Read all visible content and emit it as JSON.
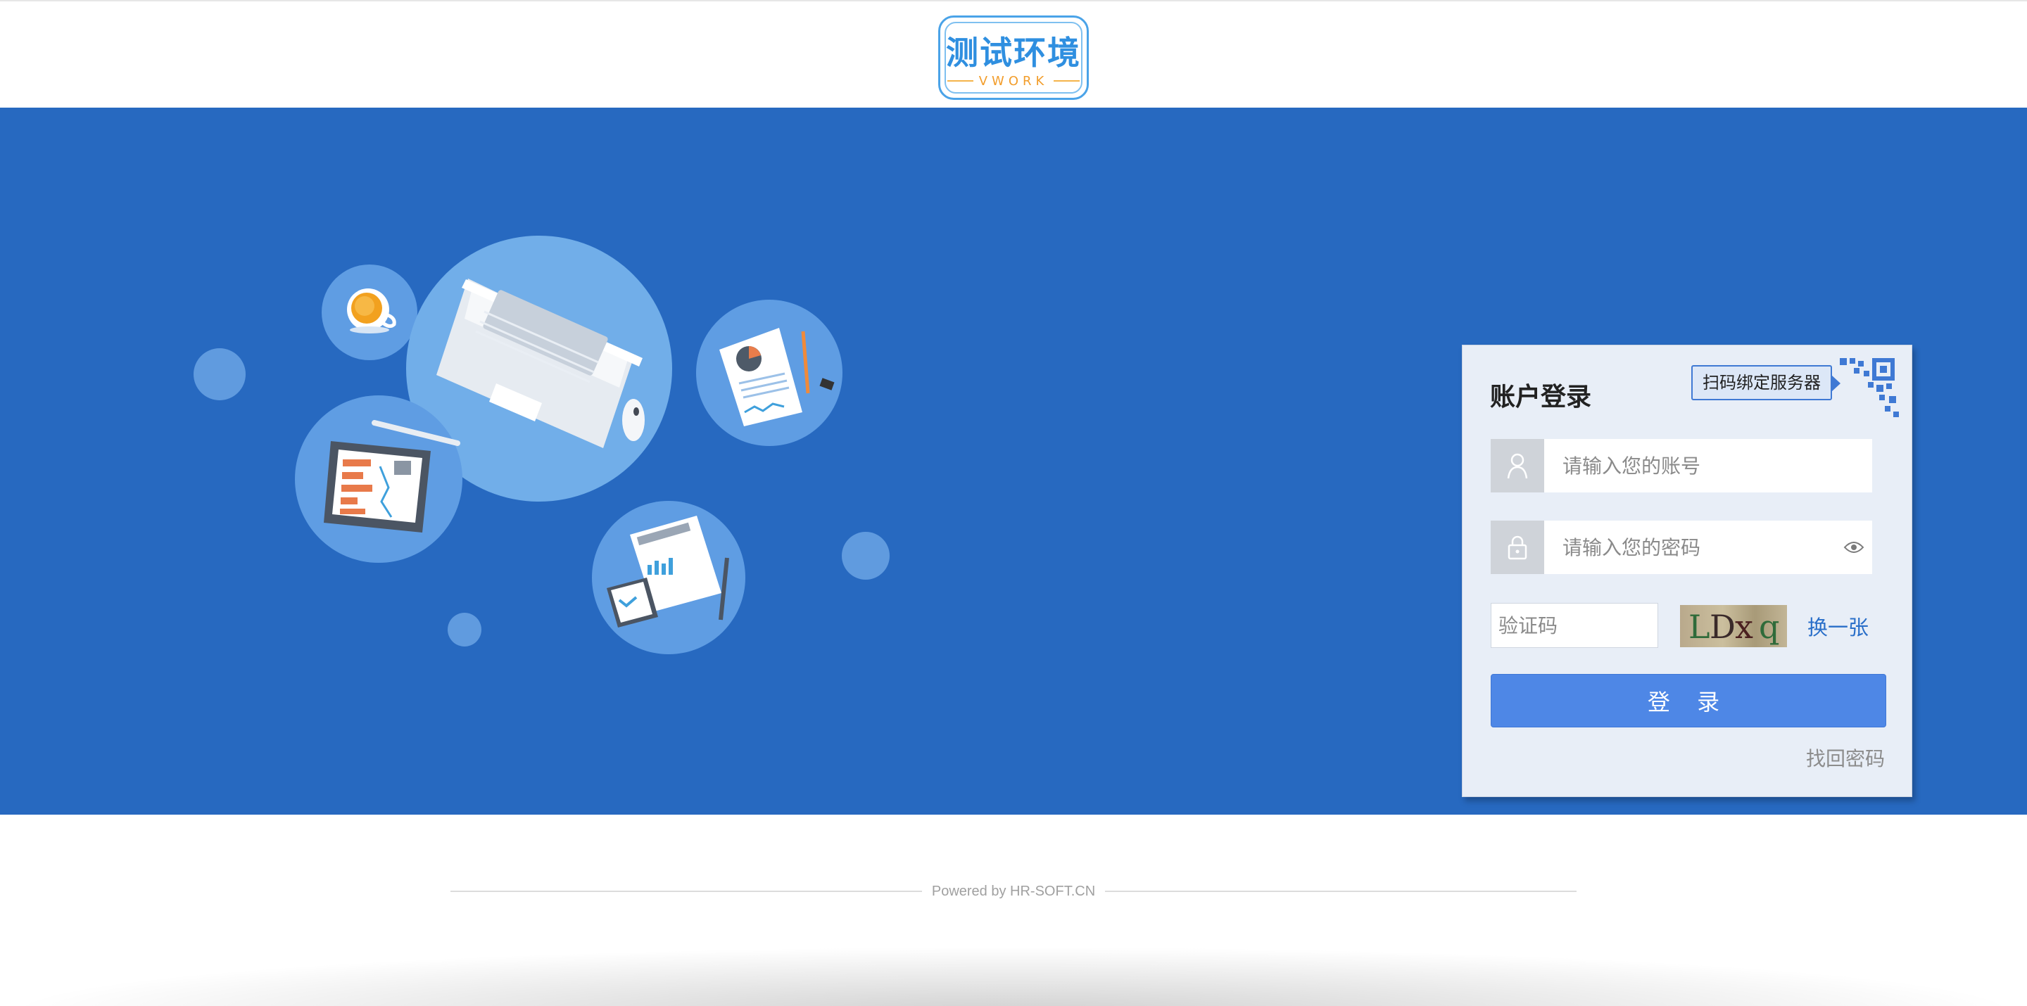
{
  "header": {
    "logo_title": "测试环境",
    "logo_subtitle": "VWORK"
  },
  "login": {
    "title": "账户登录",
    "qr_tip": "扫码绑定服务器",
    "username_placeholder": "请输入您的账号",
    "password_placeholder": "请输入您的密码",
    "captcha_placeholder": "验证码",
    "captcha_text": "LDxq",
    "refresh_label": "换一张",
    "login_button": "登 录",
    "forgot_label": "找回密码"
  },
  "footer": {
    "powered": "Powered by HR-SOFT.CN"
  },
  "colors": {
    "banner": "#2769c0",
    "button": "#4e87e6",
    "card": "#e8eef7",
    "link": "#2a6fc9"
  },
  "icons": [
    "user-icon",
    "lock-icon",
    "eye-icon",
    "qr-code-icon",
    "coffee-cup-icon",
    "laptop-icon",
    "mouse-icon",
    "tablet-icon",
    "pen-icon",
    "report-icon",
    "phone-icon"
  ]
}
